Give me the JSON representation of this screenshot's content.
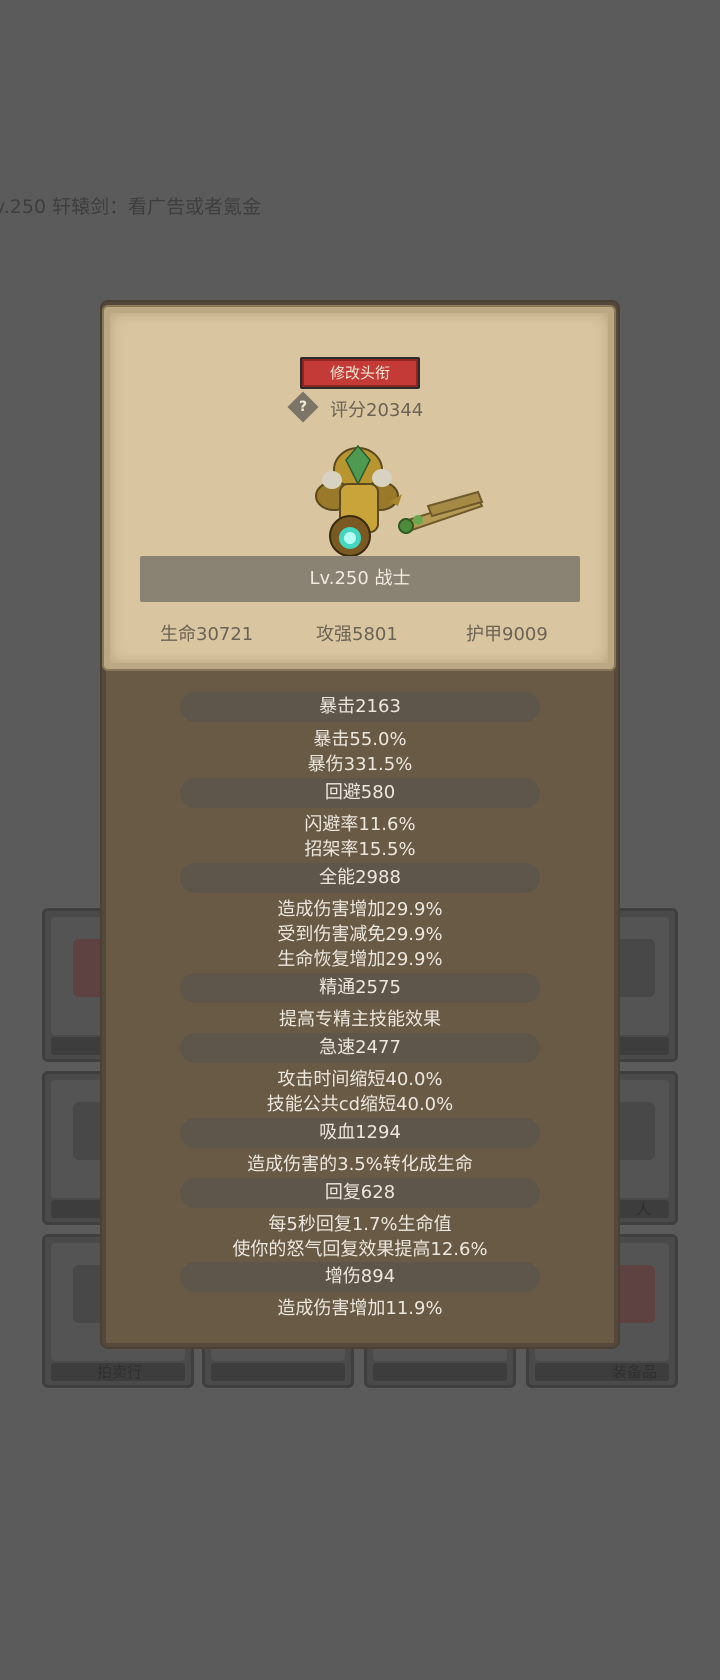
{
  "background": {
    "tip": "v.250 轩辕剑：看广告或者氪金",
    "tile_labels": [
      "拍卖行",
      "",
      "",
      "人",
      "",
      "装备品"
    ]
  },
  "card": {
    "rename_button": "修改头衔",
    "help_icon_glyph": "?",
    "score": "评分20344",
    "hero_name": "Lv.250 战士",
    "base_stats": {
      "hp": "生命30721",
      "power": "攻强5801",
      "armor": "护甲9009"
    }
  },
  "stats": [
    {
      "head": "暴击2163",
      "lines": [
        "暴击55.0%",
        "暴伤331.5%"
      ]
    },
    {
      "head": "回避580",
      "lines": [
        "闪避率11.6%",
        "招架率15.5%"
      ]
    },
    {
      "head": "全能2988",
      "lines": [
        "造成伤害增加29.9%",
        "受到伤害减免29.9%",
        "生命恢复增加29.9%"
      ]
    },
    {
      "head": "精通2575",
      "lines": [
        "提高专精主技能效果"
      ]
    },
    {
      "head": "急速2477",
      "lines": [
        "攻击时间缩短40.0%",
        "技能公共cd缩短40.0%"
      ]
    },
    {
      "head": "吸血1294",
      "lines": [
        "造成伤害的3.5%转化成生命"
      ]
    },
    {
      "head": "回复628",
      "lines": [
        "每5秒回复1.7%生命值",
        "使你的怒气回复效果提高12.6%"
      ]
    },
    {
      "head": "增伤894",
      "lines": [
        "造成伤害增加11.9%"
      ]
    }
  ],
  "colors": {
    "rename_button": "#c33a36",
    "card": "#d9c6a1",
    "panel": "#695a46",
    "backdrop": "#5b5b5b"
  }
}
